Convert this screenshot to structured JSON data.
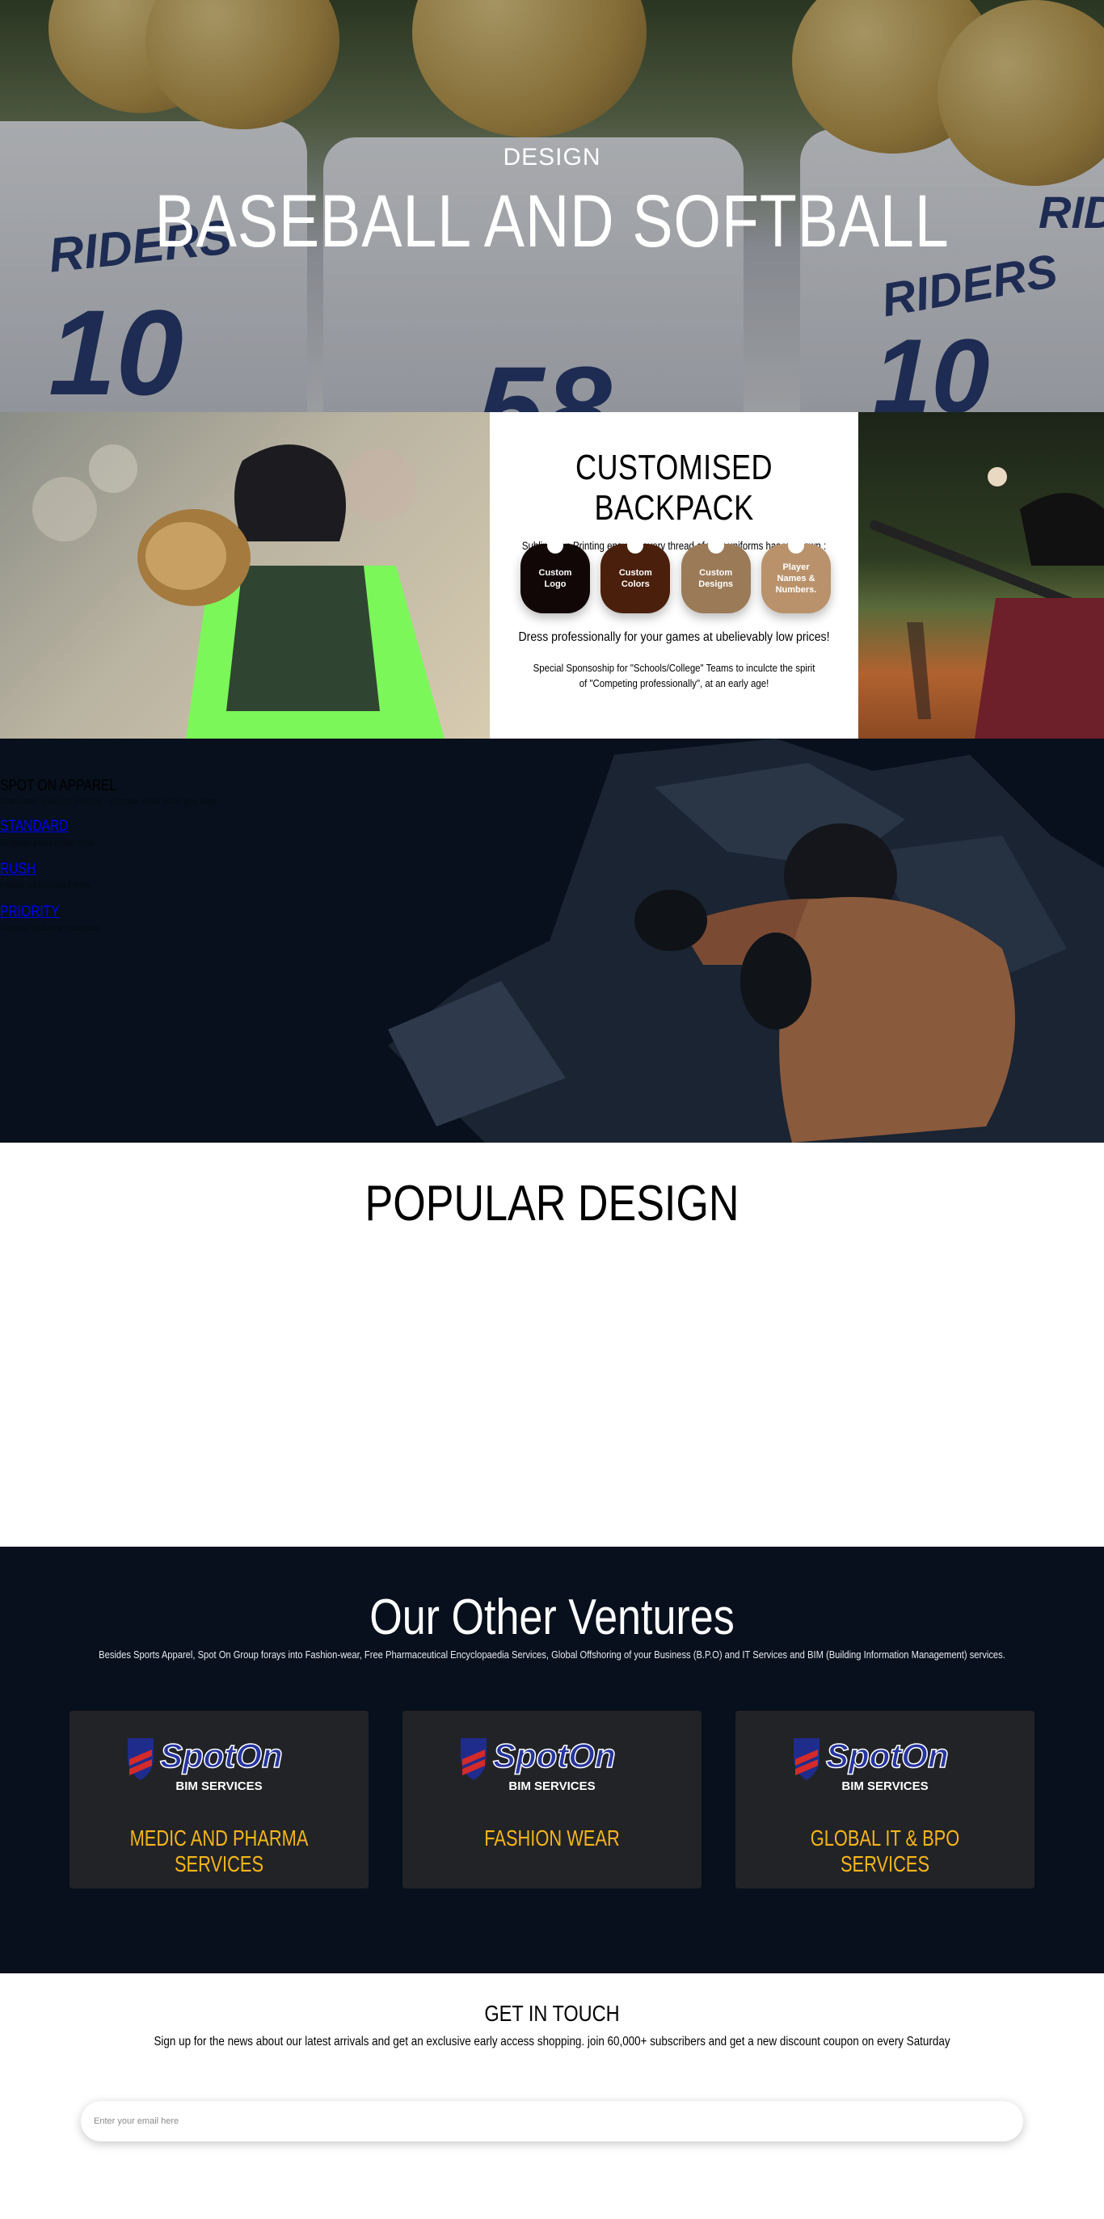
{
  "hero": {
    "eyebrow": "DESIGN",
    "title": "BASEBALL AND SOFTBALL",
    "jersey_texts": [
      "RIDERS",
      "10",
      "58",
      "RIDERS",
      "10",
      "RIDE"
    ]
  },
  "backpack": {
    "title": "CUSTOMISED BACKPACK",
    "subtitle": "Sublimation Printing ensures every thread of your uniforms has your own :",
    "tags": [
      {
        "label": "Custom Logo",
        "color": "#120707"
      },
      {
        "label": "Custom Colors",
        "color": "#4a200c"
      },
      {
        "label": "Custom Designs",
        "color": "#9b7a58"
      },
      {
        "label": "Player Names & Numbers.",
        "color": "#b9926b"
      }
    ],
    "line1": "Dress professionally for your games at ubelievably low prices!",
    "line2": "Special Sponsoship for \"Schools/College\" Teams to inculcte the spirit of \"Competing professionally\", at an early age!"
  },
  "speed": {
    "brand": "SPOT ON APPAREL",
    "tagline": "Standard, Rush or Priority - choose what suits you best",
    "options": [
      {
        "label": "STANDARD",
        "desc": "Regular production time"
      },
      {
        "label": "RUSH",
        "desc": "Faster turnaround time"
      },
      {
        "label": "PRIORITY",
        "desc": "Fastest delivery available"
      }
    ]
  },
  "popular": {
    "title": "POPULAR DESIGN"
  },
  "ventures": {
    "title": "Our Other Ventures",
    "subtitle": "Besides Sports Apparel, Spot On Group forays into Fashion-wear, Free Pharmaceutical Encyclopaedia Services, Global Offshoring of your Business (B.P.O) and IT Services and BIM (Building Information Management) services.",
    "logo_text": "SpotOn",
    "logo_sub": "BIM SERVICES",
    "cards": [
      {
        "label": "MEDIC AND PHARMA SERVICES"
      },
      {
        "label": "FASHION WEAR"
      },
      {
        "label": "GLOBAL IT & BPO SERVICES"
      }
    ],
    "accent": "#f5b51b"
  },
  "touch": {
    "title": "GET IN TOUCH",
    "subtitle": "Sign up for the news about our latest arrivals and get an exclusive early access shopping. join 60,000+ subscribers and get a new discount coupon on every Saturday",
    "email_placeholder": "Enter your email here"
  }
}
